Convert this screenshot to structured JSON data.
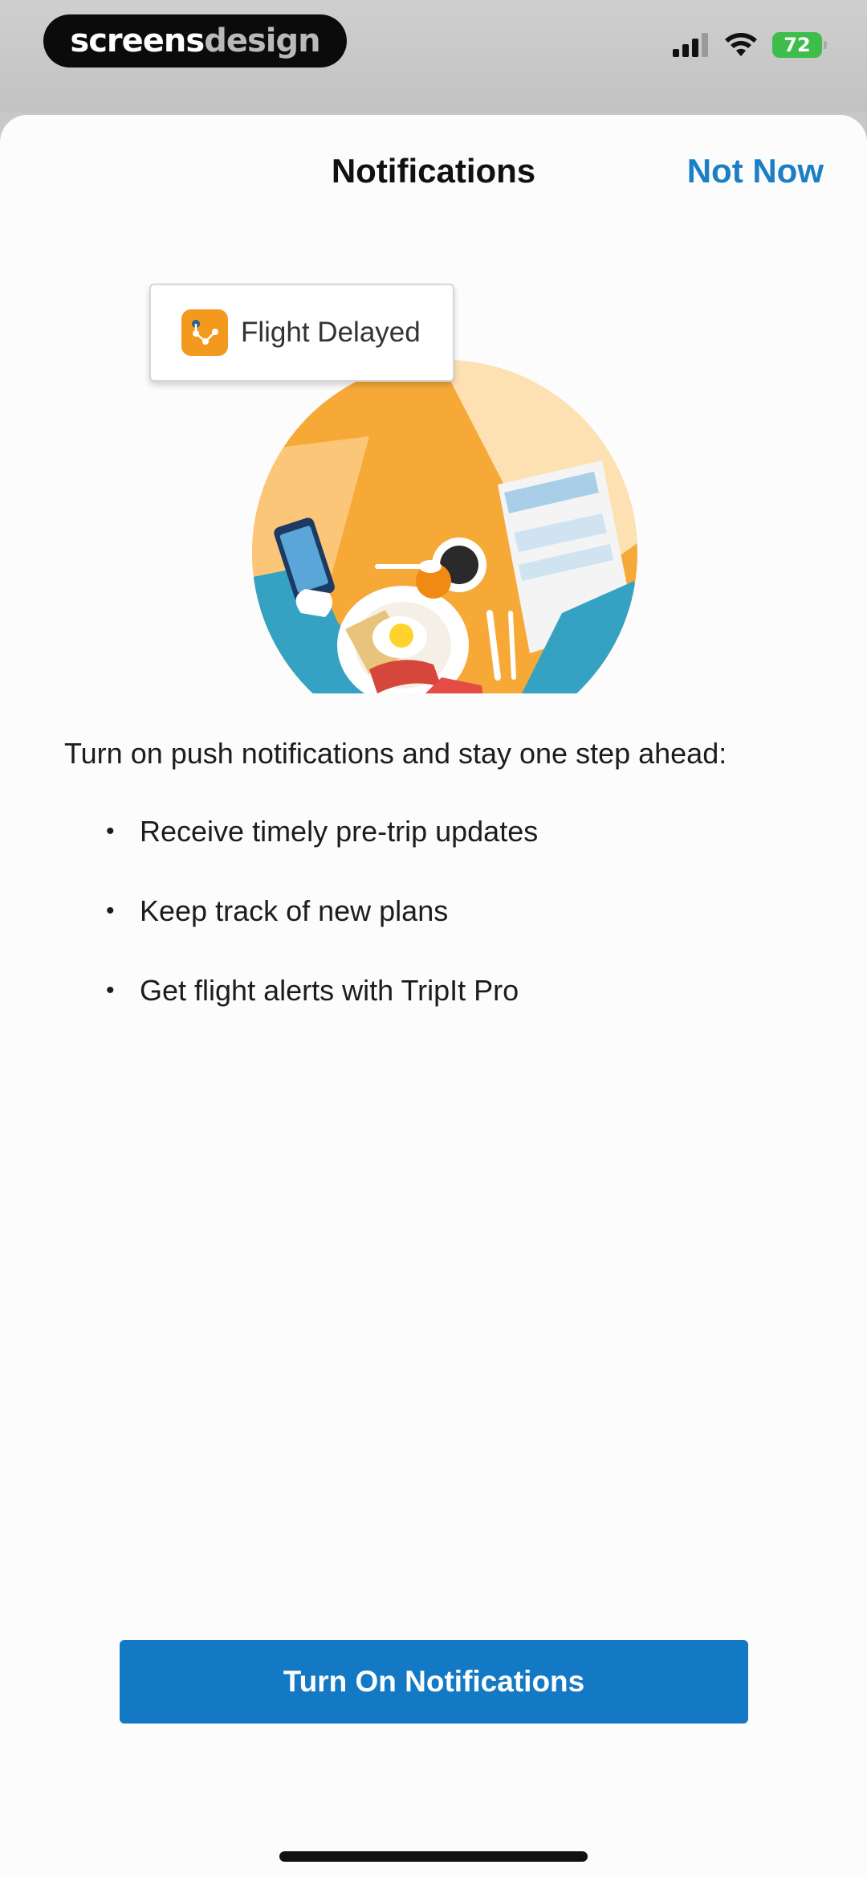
{
  "status_bar": {
    "brand_part1": "screens",
    "brand_part2": "design",
    "battery": "72"
  },
  "header": {
    "title": "Notifications",
    "dismiss_label": "Not Now"
  },
  "illustration": {
    "notification_label": "Flight Delayed",
    "app_icon": "tripit-app-icon"
  },
  "content": {
    "intro": "Turn on push notifications and stay one step ahead:",
    "bullets": [
      "Receive timely pre-trip updates",
      "Keep track of new plans",
      "Get flight alerts with TripIt Pro"
    ]
  },
  "cta": {
    "label": "Turn On Notifications"
  },
  "colors": {
    "accent": "#1479c5",
    "link": "#1a7fc4",
    "app_icon_orange": "#f39a1e"
  }
}
